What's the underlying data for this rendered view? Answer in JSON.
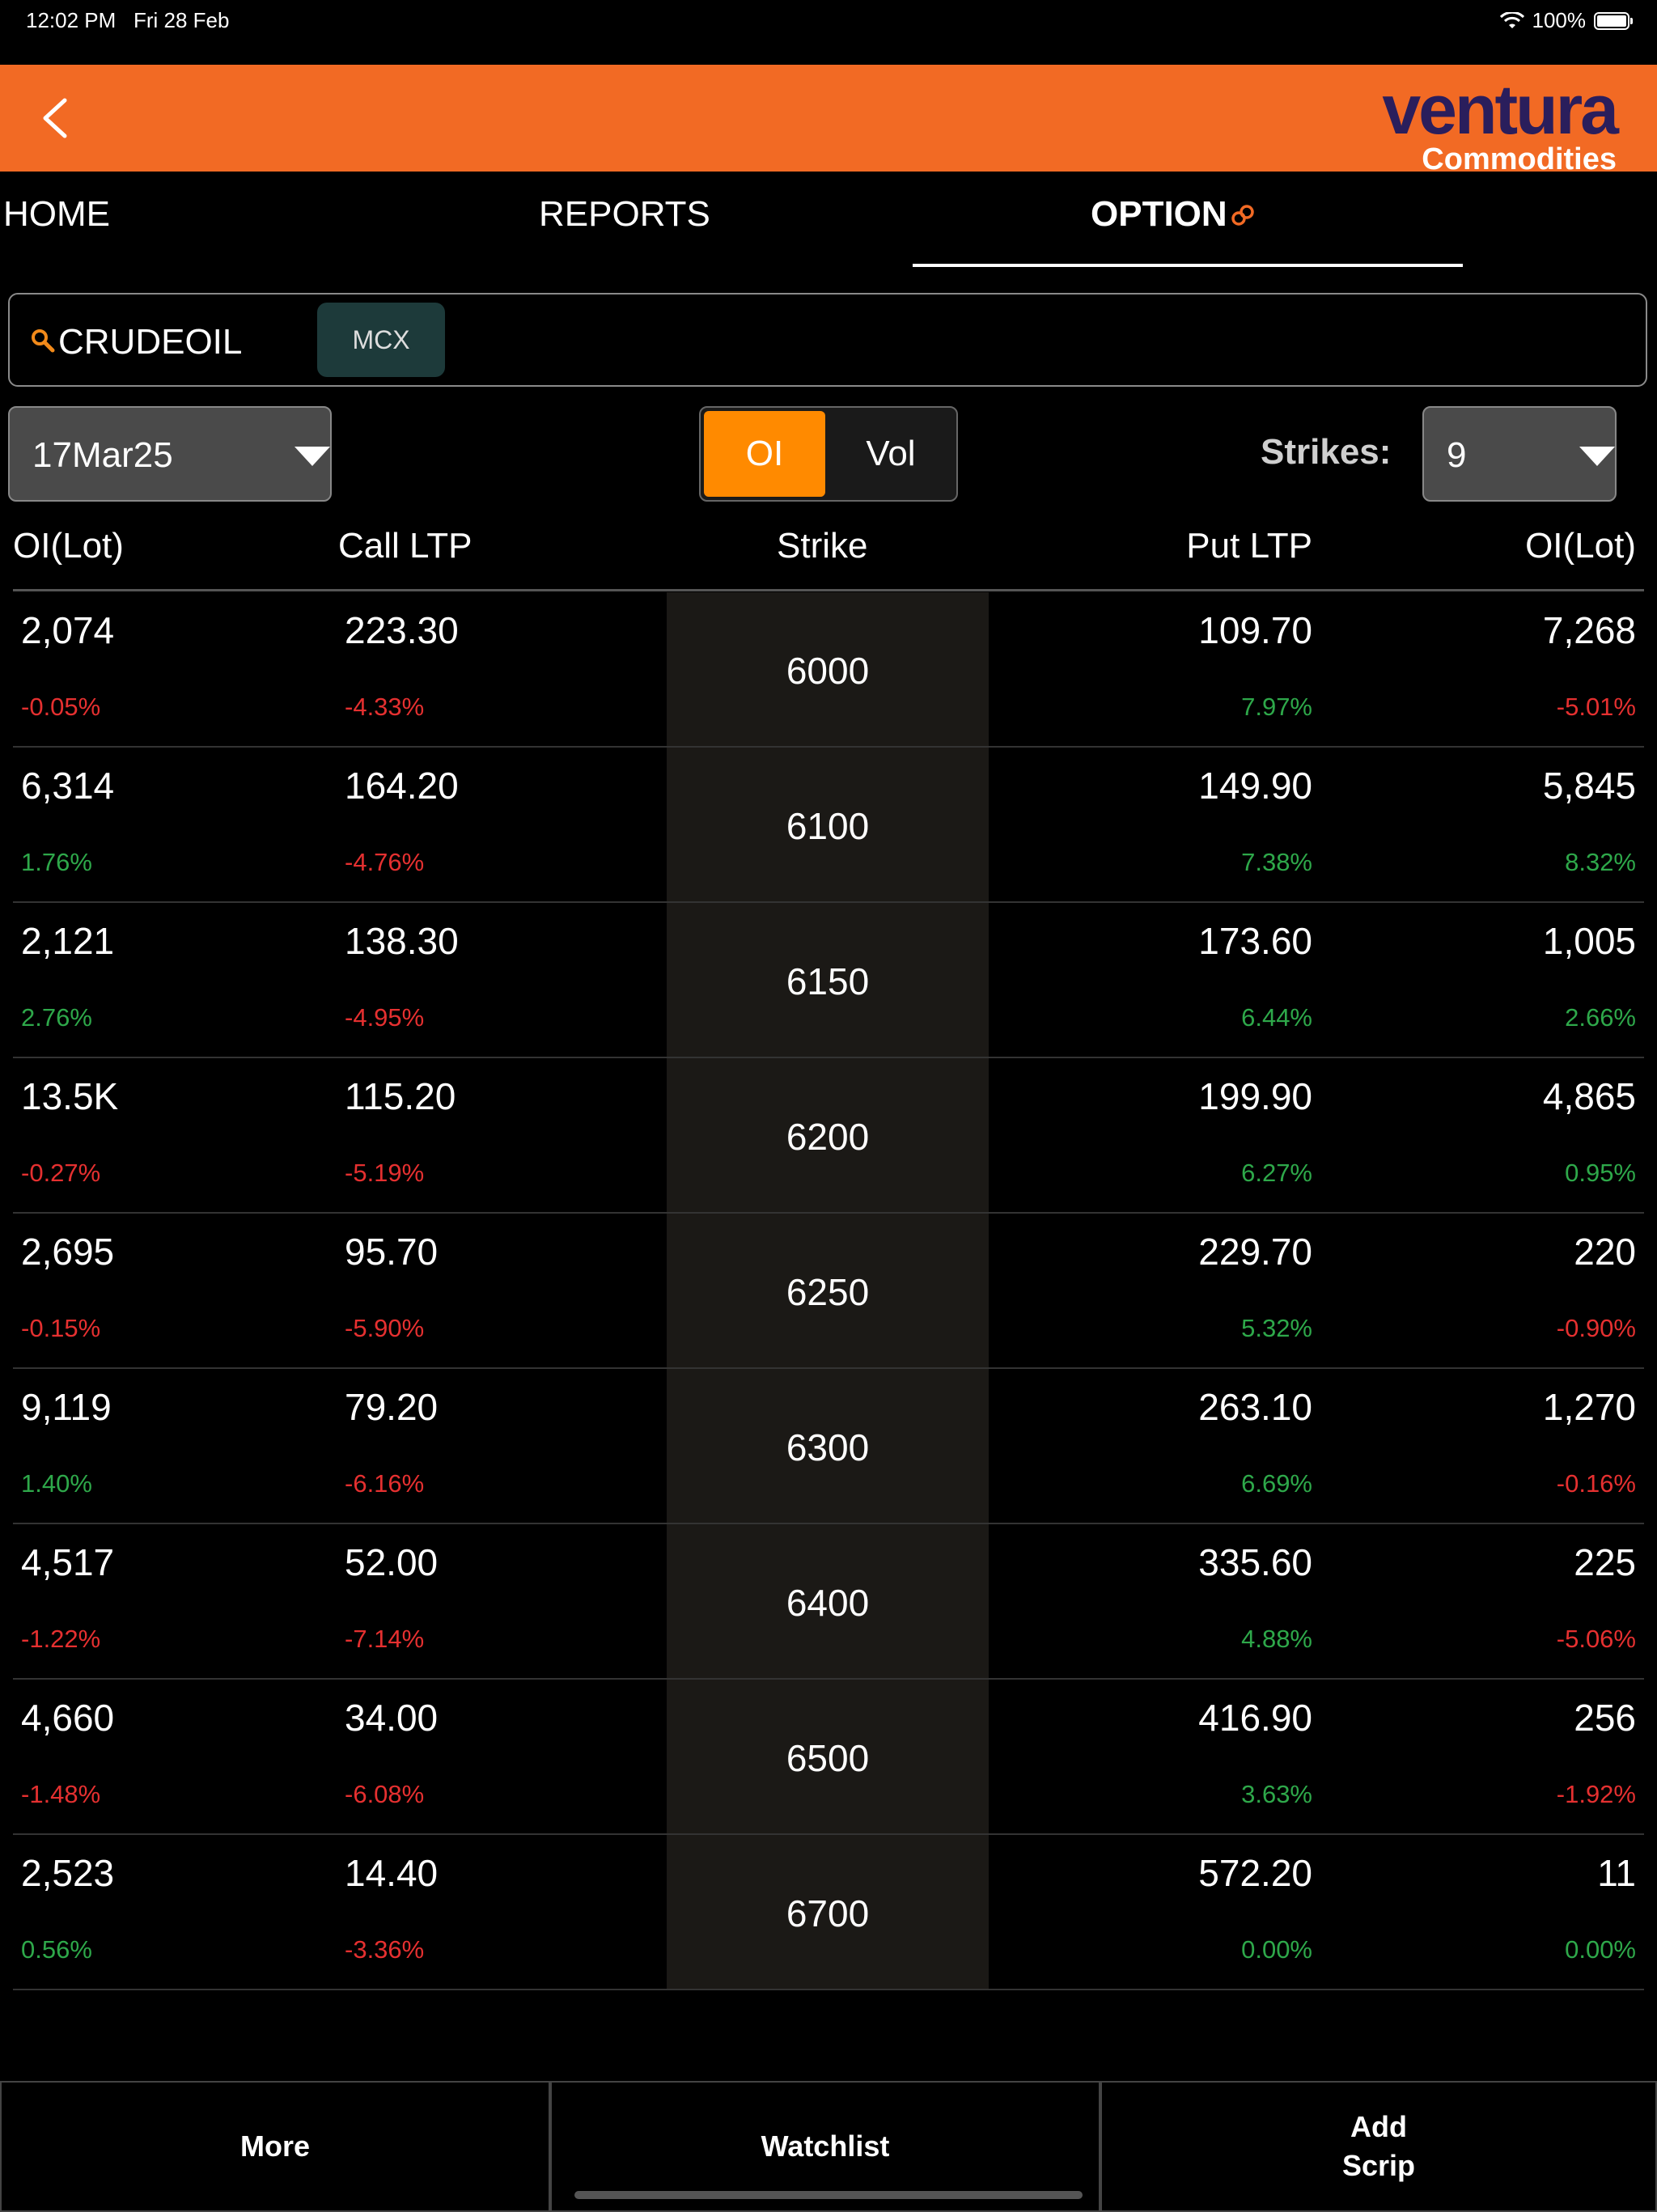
{
  "status": {
    "time": "12:02 PM",
    "date": "Fri 28 Feb",
    "battery": "100%"
  },
  "header": {
    "logo_word": "ventura",
    "logo_sub": "Commodities"
  },
  "tabs": {
    "home": "HOME",
    "reports": "REPORTS",
    "option": "OPTION"
  },
  "search": {
    "value": "CRUDEOIL",
    "exchange": "MCX"
  },
  "controls": {
    "expiry": "17Mar25",
    "toggle_oi": "OI",
    "toggle_vol": "Vol",
    "strikes_label": "Strikes:",
    "strikes_value": "9"
  },
  "columns": {
    "oi_left": "OI(Lot)",
    "call_ltp": "Call LTP",
    "strike": "Strike",
    "put_ltp": "Put LTP",
    "oi_right": "OI(Lot)"
  },
  "rows": [
    {
      "call_oi": "2,074",
      "call_oi_chg": "-0.05%",
      "call_oi_dir": "down",
      "call_ltp": "223.30",
      "call_ltp_chg": "-4.33%",
      "call_ltp_dir": "down",
      "strike": "6000",
      "put_ltp": "109.70",
      "put_ltp_chg": "7.97%",
      "put_ltp_dir": "up",
      "put_oi": "7,268",
      "put_oi_chg": "-5.01%",
      "put_oi_dir": "down"
    },
    {
      "call_oi": "6,314",
      "call_oi_chg": "1.76%",
      "call_oi_dir": "up",
      "call_ltp": "164.20",
      "call_ltp_chg": "-4.76%",
      "call_ltp_dir": "down",
      "strike": "6100",
      "put_ltp": "149.90",
      "put_ltp_chg": "7.38%",
      "put_ltp_dir": "up",
      "put_oi": "5,845",
      "put_oi_chg": "8.32%",
      "put_oi_dir": "up"
    },
    {
      "call_oi": "2,121",
      "call_oi_chg": "2.76%",
      "call_oi_dir": "up",
      "call_ltp": "138.30",
      "call_ltp_chg": "-4.95%",
      "call_ltp_dir": "down",
      "strike": "6150",
      "put_ltp": "173.60",
      "put_ltp_chg": "6.44%",
      "put_ltp_dir": "up",
      "put_oi": "1,005",
      "put_oi_chg": "2.66%",
      "put_oi_dir": "up"
    },
    {
      "call_oi": "13.5K",
      "call_oi_chg": "-0.27%",
      "call_oi_dir": "down",
      "call_ltp": "115.20",
      "call_ltp_chg": "-5.19%",
      "call_ltp_dir": "down",
      "strike": "6200",
      "put_ltp": "199.90",
      "put_ltp_chg": "6.27%",
      "put_ltp_dir": "up",
      "put_oi": "4,865",
      "put_oi_chg": "0.95%",
      "put_oi_dir": "up"
    },
    {
      "call_oi": "2,695",
      "call_oi_chg": "-0.15%",
      "call_oi_dir": "down",
      "call_ltp": "95.70",
      "call_ltp_chg": "-5.90%",
      "call_ltp_dir": "down",
      "strike": "6250",
      "put_ltp": "229.70",
      "put_ltp_chg": "5.32%",
      "put_ltp_dir": "up",
      "put_oi": "220",
      "put_oi_chg": "-0.90%",
      "put_oi_dir": "down"
    },
    {
      "call_oi": "9,119",
      "call_oi_chg": "1.40%",
      "call_oi_dir": "up",
      "call_ltp": "79.20",
      "call_ltp_chg": "-6.16%",
      "call_ltp_dir": "down",
      "strike": "6300",
      "put_ltp": "263.10",
      "put_ltp_chg": "6.69%",
      "put_ltp_dir": "up",
      "put_oi": "1,270",
      "put_oi_chg": "-0.16%",
      "put_oi_dir": "down"
    },
    {
      "call_oi": "4,517",
      "call_oi_chg": "-1.22%",
      "call_oi_dir": "down",
      "call_ltp": "52.00",
      "call_ltp_chg": "-7.14%",
      "call_ltp_dir": "down",
      "strike": "6400",
      "put_ltp": "335.60",
      "put_ltp_chg": "4.88%",
      "put_ltp_dir": "up",
      "put_oi": "225",
      "put_oi_chg": "-5.06%",
      "put_oi_dir": "down"
    },
    {
      "call_oi": "4,660",
      "call_oi_chg": "-1.48%",
      "call_oi_dir": "down",
      "call_ltp": "34.00",
      "call_ltp_chg": "-6.08%",
      "call_ltp_dir": "down",
      "strike": "6500",
      "put_ltp": "416.90",
      "put_ltp_chg": "3.63%",
      "put_ltp_dir": "up",
      "put_oi": "256",
      "put_oi_chg": "-1.92%",
      "put_oi_dir": "down"
    },
    {
      "call_oi": "2,523",
      "call_oi_chg": "0.56%",
      "call_oi_dir": "up",
      "call_ltp": "14.40",
      "call_ltp_chg": "-3.36%",
      "call_ltp_dir": "down",
      "strike": "6700",
      "put_ltp": "572.20",
      "put_ltp_chg": "0.00%",
      "put_ltp_dir": "up",
      "put_oi": "11",
      "put_oi_chg": "0.00%",
      "put_oi_dir": "up"
    }
  ],
  "bottom": {
    "more": "More",
    "watchlist": "Watchlist",
    "add_scrip_line1": "Add",
    "add_scrip_line2": "Scrip"
  },
  "colors": {
    "accent": "#f26a24",
    "toggle_active": "#ff8a00",
    "up": "#2ea84a",
    "down": "#e53030",
    "logo": "#2a1e5c"
  }
}
